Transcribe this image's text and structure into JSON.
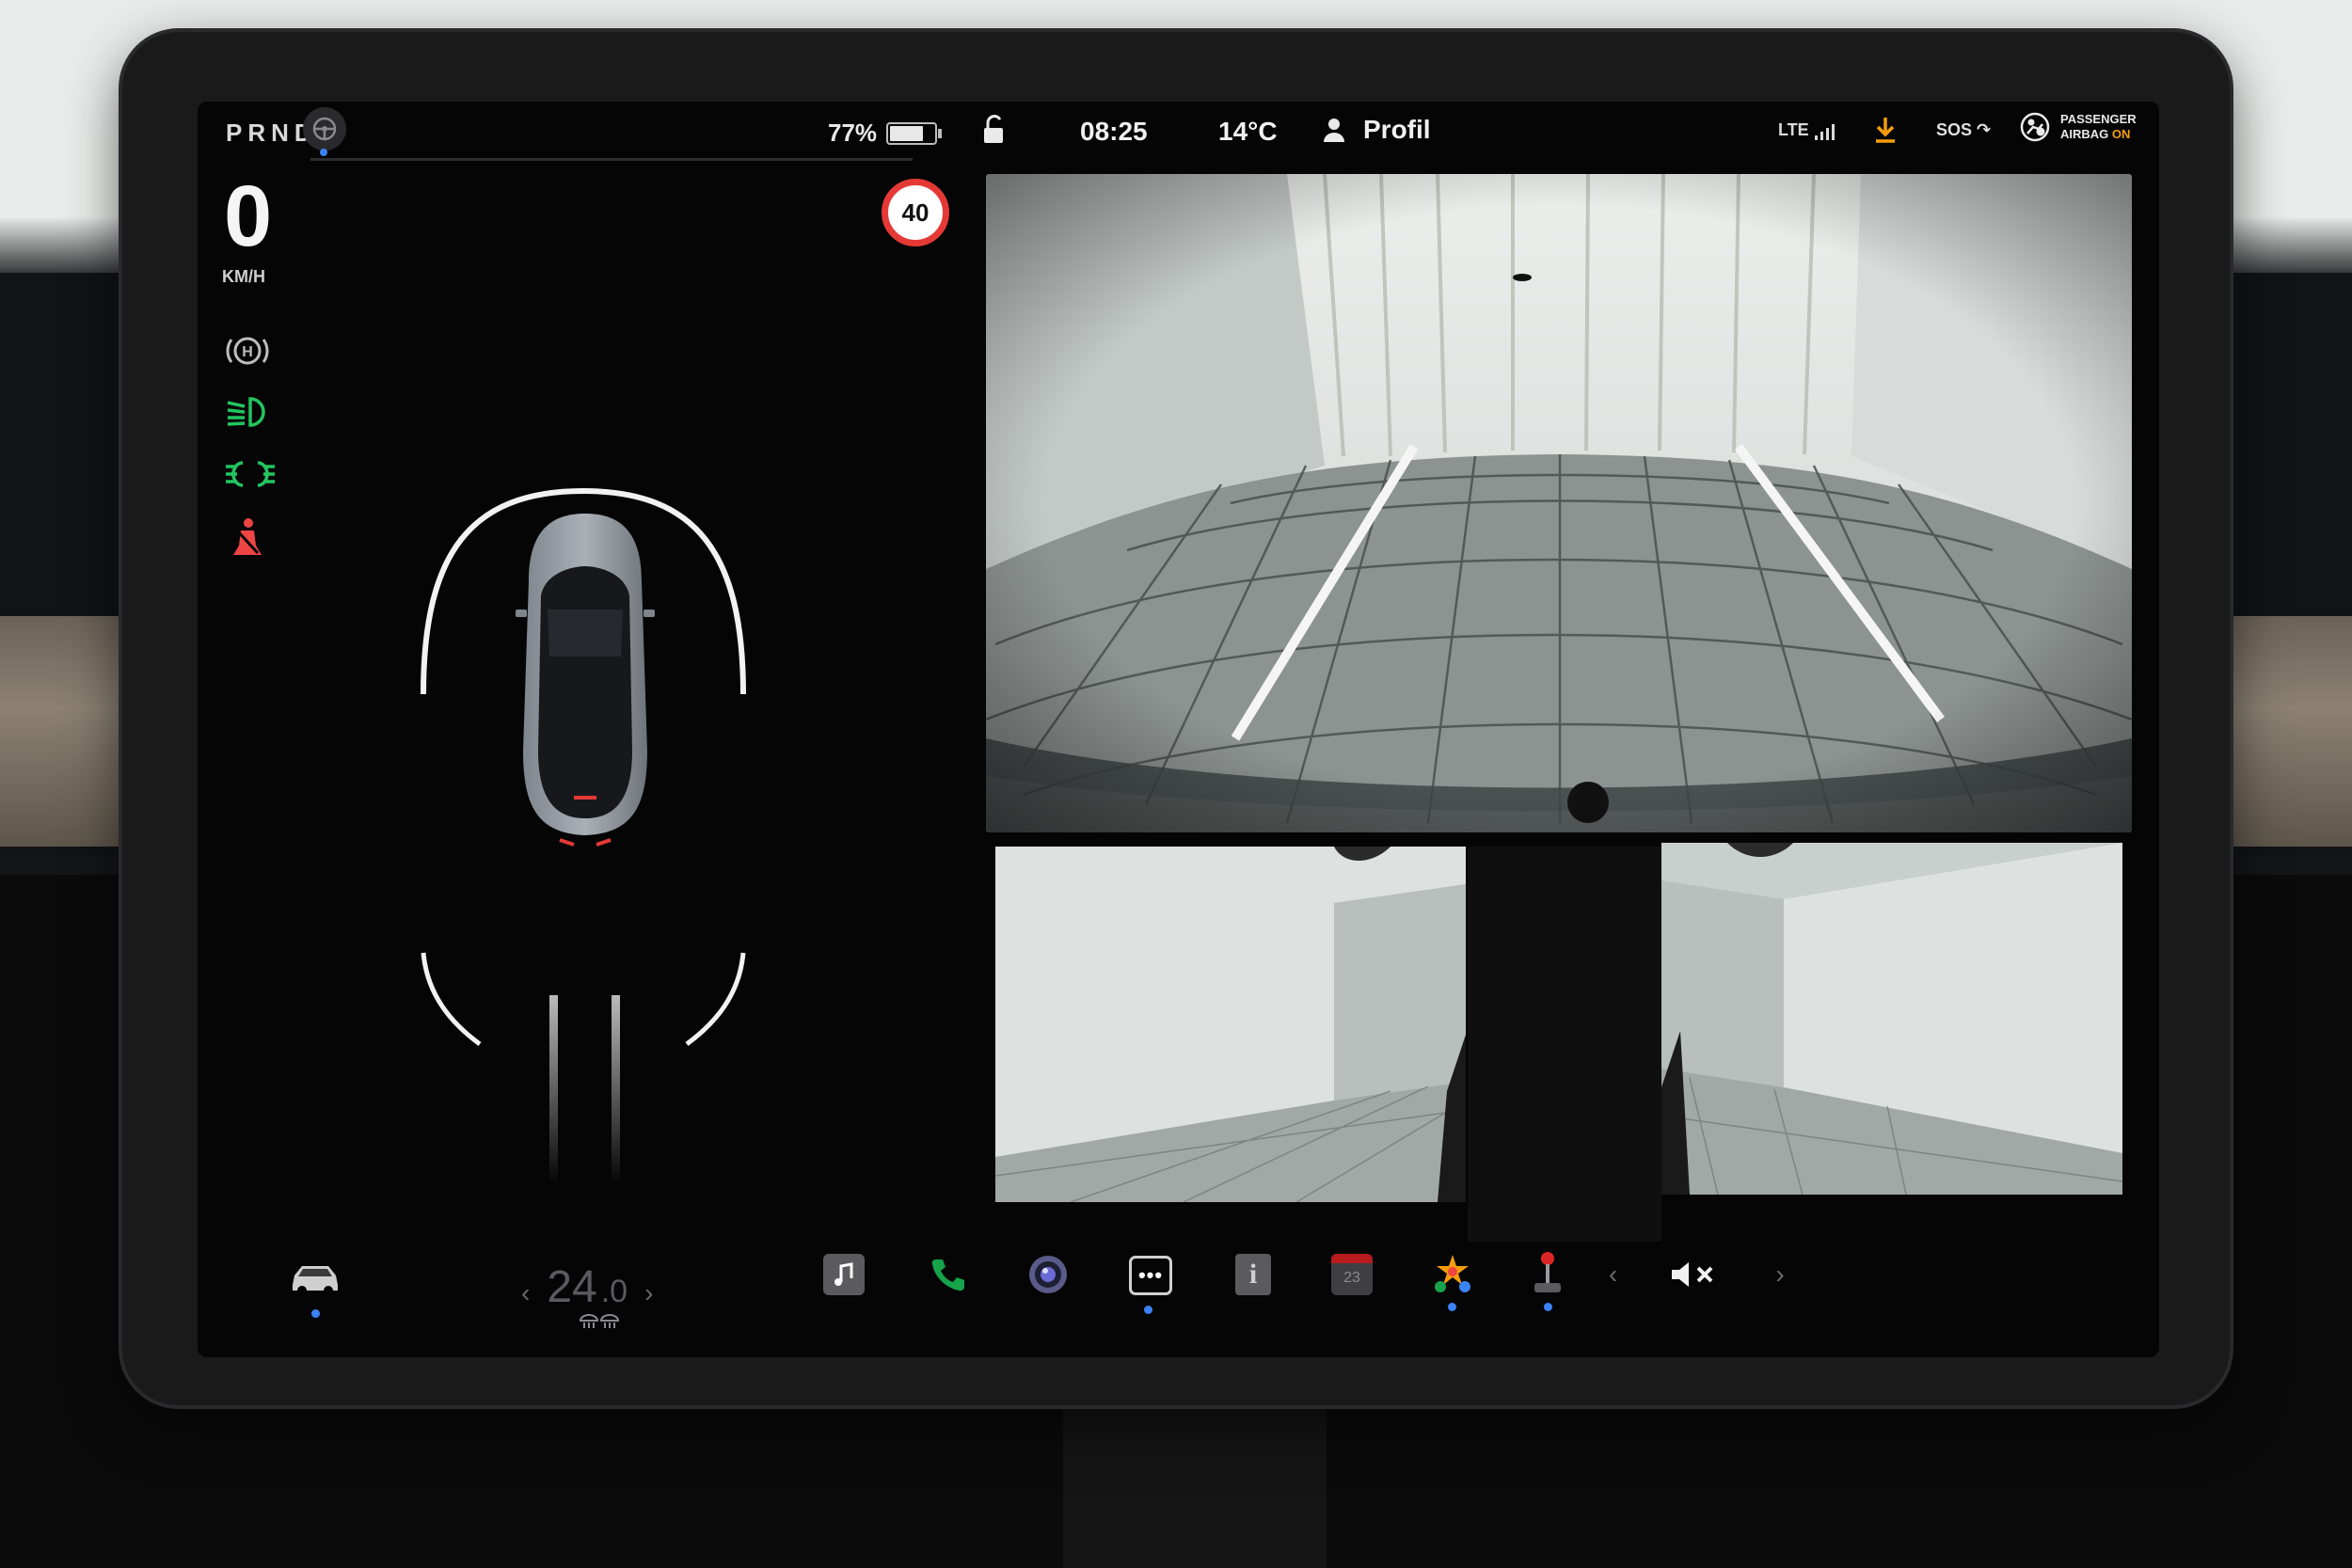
{
  "status_bar": {
    "gear_selector": "PRND",
    "battery_percent_label": "77%",
    "battery_level": 0.77,
    "time": "08:25",
    "temperature": "14°C",
    "profile_label": "Profil",
    "network": "LTE",
    "sos_label": "SOS",
    "airbag_line1": "PASSENGER",
    "airbag_line2": "AIRBAG",
    "airbag_state": "ON"
  },
  "driving": {
    "speed": "0",
    "speed_unit": "KM/H",
    "speed_limit": "40"
  },
  "telltales": [
    {
      "icon": "auto-hold-icon",
      "color": "#bdbdbd"
    },
    {
      "icon": "low-beam-icon",
      "color": "#22c55e"
    },
    {
      "icon": "parking-lights-icon",
      "color": "#22c55e"
    },
    {
      "icon": "seatbelt-warning-icon",
      "color": "#ef4444"
    }
  ],
  "dock": {
    "climate_temp": "24",
    "climate_temp_decimal": ".0",
    "items": [
      "car-icon",
      "music-icon",
      "phone-icon",
      "camera-icon",
      "more-icon",
      "manual-icon",
      "calendar-icon",
      "games-icon",
      "joystick-icon"
    ],
    "calendar_day": "23",
    "volume_state": "muted"
  },
  "colors": {
    "accent_blue": "#3b82f6",
    "ok_green": "#22c55e",
    "warn_red": "#ef4444",
    "airbag_on": "#f59e0b"
  }
}
